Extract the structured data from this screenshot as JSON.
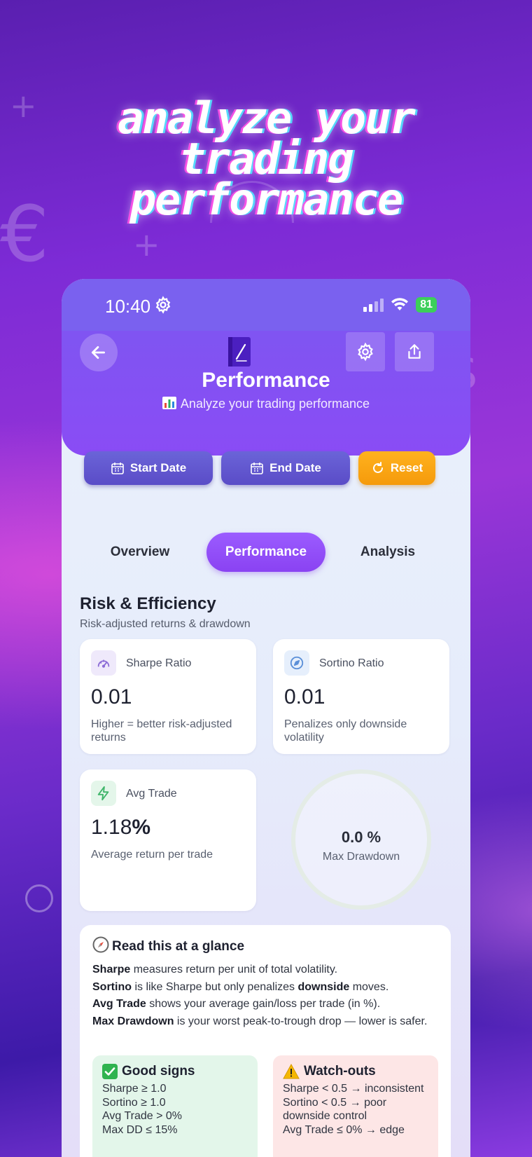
{
  "headline": {
    "line1": "analyze your",
    "line2": "trading",
    "line3": "performance"
  },
  "status_bar": {
    "time": "10:40",
    "battery": "81"
  },
  "header": {
    "title": "Performance",
    "subtitle": "Analyze your trading performance"
  },
  "filters": {
    "start_label": "Start Date",
    "end_label": "End Date",
    "reset_label": "Reset"
  },
  "tabs": [
    {
      "label": "Overview",
      "active": false
    },
    {
      "label": "Performance",
      "active": true
    },
    {
      "label": "Analysis",
      "active": false
    }
  ],
  "section": {
    "title": "Risk & Efficiency",
    "subtitle": "Risk-adjusted returns & drawdown"
  },
  "metrics": {
    "sharpe": {
      "label": "Sharpe Ratio",
      "value": "0.01",
      "desc": "Higher = better risk-adjusted returns"
    },
    "sortino": {
      "label": "Sortino Ratio",
      "value": "0.01",
      "desc": "Penalizes only downside volatility"
    },
    "avg_trade": {
      "label": "Avg Trade",
      "value": "1.18",
      "unit": "%",
      "desc": "Average return per trade"
    },
    "max_drawdown": {
      "label": "Max Drawdown",
      "value": "0.0 %"
    }
  },
  "glance": {
    "title": "Read this at a glance",
    "lines": [
      {
        "bold": "Sharpe",
        "rest": " measures return per unit of total volatility."
      },
      {
        "bold": "Sortino",
        "rest": " is like Sharpe but only penalizes ",
        "bold2": "downside",
        "rest2": " moves."
      },
      {
        "bold": "Avg Trade",
        "rest": " shows your average gain/loss per trade (in %)."
      },
      {
        "bold": "Max Drawdown",
        "rest": " is your worst peak-to-trough drop — lower is safer."
      }
    ],
    "good": {
      "title": "Good signs",
      "items": [
        "Sharpe ≥ 1.0",
        "Sortino ≥ 1.0",
        "Avg Trade > 0%",
        "Max DD ≤ 15%"
      ]
    },
    "watch": {
      "title": "Watch-outs",
      "items": [
        "Sharpe < 0.5 → inconsistent",
        "Sortino < 0.5 → poor downside control",
        "Avg Trade ≤ 0% → edge"
      ]
    }
  }
}
